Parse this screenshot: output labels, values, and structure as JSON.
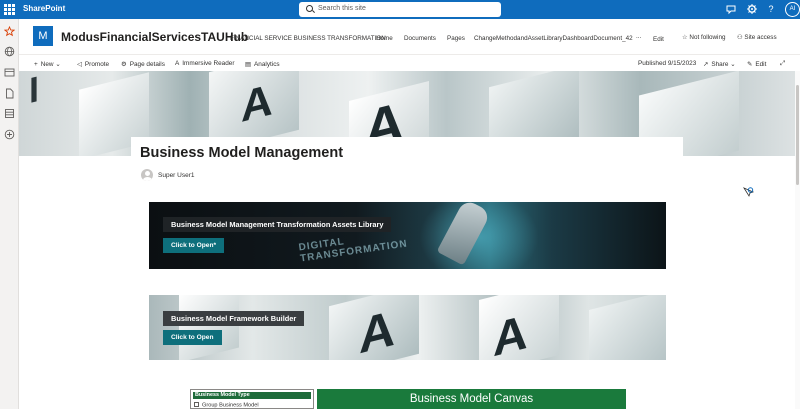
{
  "suite_bar": {
    "app_name": "SharePoint",
    "search_placeholder": "Search this site",
    "avatar_initials": "AI"
  },
  "site": {
    "logo_letter": "M",
    "title": "ModusFinancialServicesTAUHub",
    "nav": [
      "FINANCIAL SERVICE BUSINESS TRANSFORMATION",
      "Home",
      "Documents",
      "Pages",
      "ChangeMethodandAssetLibraryDashboardDocument_42",
      "...",
      "Edit"
    ],
    "not_following": "Not following",
    "site_access": "Site access"
  },
  "command_bar": {
    "new": "New",
    "promote": "Promote",
    "page_details": "Page details",
    "immersive_reader": "Immersive Reader",
    "analytics": "Analytics",
    "published": "Published 9/15/2023",
    "share": "Share",
    "edit": "Edit"
  },
  "page": {
    "title": "Business Model Management",
    "author": "Super User1"
  },
  "banner1": {
    "title": "Business Model Management Transformation Assets Library",
    "button": "Click to Open*",
    "overlay_text_1": "DIGITAL",
    "overlay_text_2": "TRANSFORMATION"
  },
  "banner2": {
    "title": "Business Model Framework Builder",
    "button": "Click to Open"
  },
  "bottom": {
    "type_header": "Business Model Type",
    "type_option": "Group Business Model",
    "canvas_title": "Business Model Canvas"
  },
  "colors": {
    "suite_blue": "#0f6cbd",
    "teal_button": "#0e6f7c",
    "canvas_green": "#1a7a3c"
  }
}
